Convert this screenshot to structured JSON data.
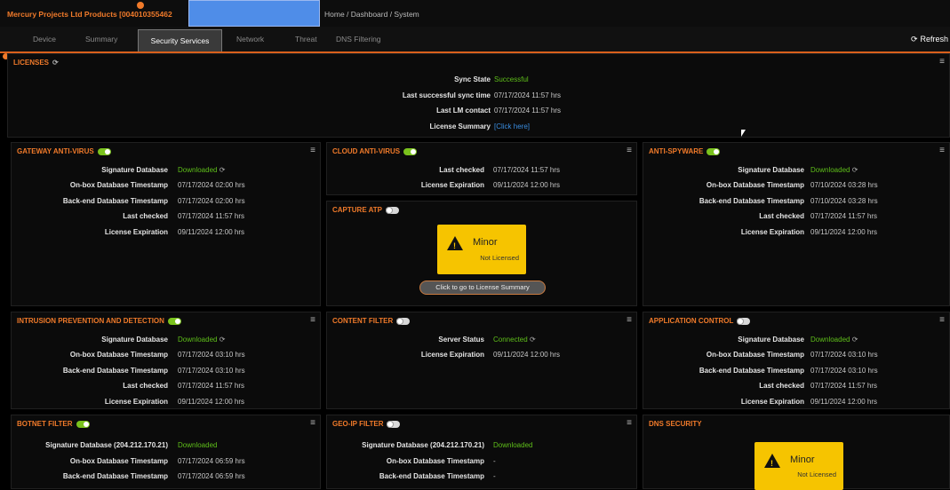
{
  "header": {
    "product": "Mercury Projects Ltd Products [004010355462",
    "breadcrumb": "Home / Dashboard / System"
  },
  "tabs": [
    "Device",
    "Summary",
    "Security Services",
    "Network",
    "Threat",
    "DNS Filtering"
  ],
  "active_tab": "Security Services",
  "refresh_label": "Refresh",
  "licenses": {
    "title": "LICENSES",
    "rows": [
      {
        "label": "Sync State",
        "value": "Successful"
      },
      {
        "label": "Last successful sync time",
        "value": "07/17/2024 11:57 hrs"
      },
      {
        "label": "Last LM contact",
        "value": "07/17/2024 11:57 hrs"
      },
      {
        "label": "License Summary",
        "value": "[Click here]"
      }
    ]
  },
  "gateway_av": {
    "title": "GATEWAY ANTI-VIRUS",
    "rows": [
      {
        "label": "Signature Database",
        "value": "Downloaded"
      },
      {
        "label": "On-box Database Timestamp",
        "value": "07/17/2024 02:00 hrs"
      },
      {
        "label": "Back-end Database Timestamp",
        "value": "07/17/2024 02:00 hrs"
      },
      {
        "label": "Last checked",
        "value": "07/17/2024 11:57 hrs"
      },
      {
        "label": "License Expiration",
        "value": "09/11/2024 12:00 hrs"
      }
    ]
  },
  "cloud_av": {
    "title": "CLOUD ANTI-VIRUS",
    "rows": [
      {
        "label": "Last checked",
        "value": "07/17/2024 11:57 hrs"
      },
      {
        "label": "License Expiration",
        "value": "09/11/2024 12:00 hrs"
      }
    ]
  },
  "capture_atp": {
    "title": "CAPTURE ATP",
    "warn_title": "Minor",
    "warn_sub": "Not Licensed",
    "button": "Click to go to License Summary"
  },
  "anti_spyware": {
    "title": "ANTI-SPYWARE",
    "rows": [
      {
        "label": "Signature Database",
        "value": "Downloaded"
      },
      {
        "label": "On-box Database Timestamp",
        "value": "07/10/2024 03:28 hrs"
      },
      {
        "label": "Back-end Database Timestamp",
        "value": "07/10/2024 03:28 hrs"
      },
      {
        "label": "Last checked",
        "value": "07/17/2024 11:57 hrs"
      },
      {
        "label": "License Expiration",
        "value": "09/11/2024 12:00 hrs"
      }
    ]
  },
  "ips": {
    "title": "INTRUSION PREVENTION AND DETECTION",
    "rows": [
      {
        "label": "Signature Database",
        "value": "Downloaded"
      },
      {
        "label": "On-box Database Timestamp",
        "value": "07/17/2024 03:10 hrs"
      },
      {
        "label": "Back-end Database Timestamp",
        "value": "07/17/2024 03:10 hrs"
      },
      {
        "label": "Last checked",
        "value": "07/17/2024 11:57 hrs"
      },
      {
        "label": "License Expiration",
        "value": "09/11/2024 12:00 hrs"
      }
    ]
  },
  "content_filter": {
    "title": "CONTENT FILTER",
    "rows": [
      {
        "label": "Server Status",
        "value": "Connected"
      },
      {
        "label": "License Expiration",
        "value": "09/11/2024 12:00 hrs"
      }
    ]
  },
  "app_control": {
    "title": "APPLICATION CONTROL",
    "rows": [
      {
        "label": "Signature Database",
        "value": "Downloaded"
      },
      {
        "label": "On-box Database Timestamp",
        "value": "07/17/2024 03:10 hrs"
      },
      {
        "label": "Back-end Database Timestamp",
        "value": "07/17/2024 03:10 hrs"
      },
      {
        "label": "Last checked",
        "value": "07/17/2024 11:57 hrs"
      },
      {
        "label": "License Expiration",
        "value": "09/11/2024 12:00 hrs"
      }
    ]
  },
  "botnet": {
    "title": "BOTNET FILTER",
    "rows": [
      {
        "label": "Signature Database (204.212.170.21)",
        "value": "Downloaded"
      },
      {
        "label": "On-box Database Timestamp",
        "value": "07/17/2024 06:59 hrs"
      },
      {
        "label": "Back-end Database Timestamp",
        "value": "07/17/2024 06:59 hrs"
      }
    ]
  },
  "geoip": {
    "title": "GEO-IP FILTER",
    "rows": [
      {
        "label": "Signature Database (204.212.170.21)",
        "value": "Downloaded"
      },
      {
        "label": "On-box Database Timestamp",
        "value": "-"
      },
      {
        "label": "Back-end Database Timestamp",
        "value": "-"
      }
    ]
  },
  "dns_security": {
    "title": "DNS SECURITY",
    "warn_title": "Minor",
    "warn_sub": "Not Licensed"
  },
  "colors": {
    "accent": "#f07a2a",
    "ok": "#5fbf1a",
    "link": "#3a8de0",
    "warn": "#f6c400"
  }
}
